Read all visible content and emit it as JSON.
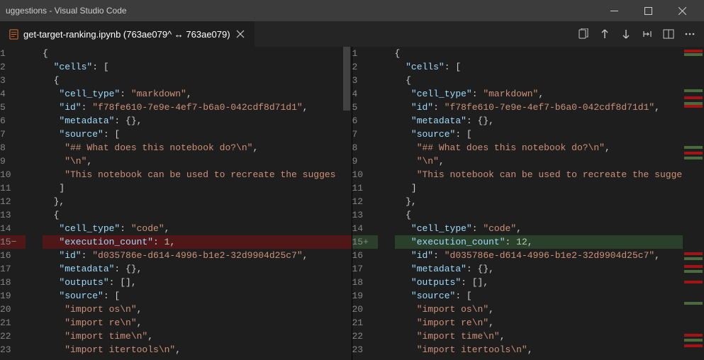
{
  "window": {
    "title_suffix": "uggestions - Visual Studio Code"
  },
  "tab": {
    "filename": "get-target-ranking.ipynb (763ae079^ ↔ 763ae079)"
  },
  "diff": {
    "left_lines": [
      {
        "n": 1,
        "tokens": [
          [
            "brace",
            "{"
          ]
        ]
      },
      {
        "n": 2,
        "tokens": [
          [
            "key",
            "  \"cells\""
          ],
          [
            "punct",
            ": ["
          ]
        ]
      },
      {
        "n": 3,
        "tokens": [
          [
            "brace",
            "  {"
          ]
        ]
      },
      {
        "n": 4,
        "tokens": [
          [
            "key",
            "   \"cell_type\""
          ],
          [
            "punct",
            ": "
          ],
          [
            "str",
            "\"markdown\""
          ],
          [
            "punct",
            ","
          ]
        ]
      },
      {
        "n": 5,
        "tokens": [
          [
            "key",
            "   \"id\""
          ],
          [
            "punct",
            ": "
          ],
          [
            "str",
            "\"f78fe610-7e9e-4ef7-b6a0-042cdf8d71d1\""
          ],
          [
            "punct",
            ","
          ]
        ]
      },
      {
        "n": 6,
        "tokens": [
          [
            "key",
            "   \"metadata\""
          ],
          [
            "punct",
            ": {},"
          ]
        ]
      },
      {
        "n": 7,
        "tokens": [
          [
            "key",
            "   \"source\""
          ],
          [
            "punct",
            ": ["
          ]
        ]
      },
      {
        "n": 8,
        "tokens": [
          [
            "str",
            "    \"## What does this notebook do?\\n\""
          ],
          [
            "punct",
            ","
          ]
        ]
      },
      {
        "n": 9,
        "tokens": [
          [
            "str",
            "    \"\\n\""
          ],
          [
            "punct",
            ","
          ]
        ]
      },
      {
        "n": 10,
        "tokens": [
          [
            "str",
            "    \"This notebook can be used to recreate the sugges"
          ]
        ]
      },
      {
        "n": 11,
        "tokens": [
          [
            "punct",
            "   ]"
          ]
        ]
      },
      {
        "n": 12,
        "tokens": [
          [
            "brace",
            "  },"
          ]
        ]
      },
      {
        "n": 13,
        "tokens": [
          [
            "brace",
            "  {"
          ]
        ]
      },
      {
        "n": 14,
        "tokens": [
          [
            "key",
            "   \"cell_type\""
          ],
          [
            "punct",
            ": "
          ],
          [
            "str",
            "\"code\""
          ],
          [
            "punct",
            ","
          ]
        ]
      },
      {
        "n": 15,
        "cls": "removed",
        "tokens": [
          [
            "key",
            "   \"execution_count\""
          ],
          [
            "punct",
            ": "
          ],
          [
            "num",
            "1"
          ],
          [
            "punct",
            ","
          ]
        ]
      },
      {
        "n": 16,
        "tokens": [
          [
            "key",
            "   \"id\""
          ],
          [
            "punct",
            ": "
          ],
          [
            "str",
            "\"d035786e-d614-4996-b1e2-32d9904d25c7\""
          ],
          [
            "punct",
            ","
          ]
        ]
      },
      {
        "n": 17,
        "tokens": [
          [
            "key",
            "   \"metadata\""
          ],
          [
            "punct",
            ": {},"
          ]
        ]
      },
      {
        "n": 18,
        "tokens": [
          [
            "key",
            "   \"outputs\""
          ],
          [
            "punct",
            ": [],"
          ]
        ]
      },
      {
        "n": 19,
        "tokens": [
          [
            "key",
            "   \"source\""
          ],
          [
            "punct",
            ": ["
          ]
        ]
      },
      {
        "n": 20,
        "tokens": [
          [
            "str",
            "    \"import os\\n\""
          ],
          [
            "punct",
            ","
          ]
        ]
      },
      {
        "n": 21,
        "tokens": [
          [
            "str",
            "    \"import re\\n\""
          ],
          [
            "punct",
            ","
          ]
        ]
      },
      {
        "n": 22,
        "tokens": [
          [
            "str",
            "    \"import time\\n\""
          ],
          [
            "punct",
            ","
          ]
        ]
      },
      {
        "n": 23,
        "tokens": [
          [
            "str",
            "    \"import itertools\\n\""
          ],
          [
            "punct",
            ","
          ]
        ]
      }
    ],
    "right_lines": [
      {
        "n": 1,
        "tokens": [
          [
            "brace",
            "{"
          ]
        ]
      },
      {
        "n": 2,
        "tokens": [
          [
            "key",
            "  \"cells\""
          ],
          [
            "punct",
            ": ["
          ]
        ]
      },
      {
        "n": 3,
        "tokens": [
          [
            "brace",
            "  {"
          ]
        ]
      },
      {
        "n": 4,
        "tokens": [
          [
            "key",
            "   \"cell_type\""
          ],
          [
            "punct",
            ": "
          ],
          [
            "str",
            "\"markdown\""
          ],
          [
            "punct",
            ","
          ]
        ]
      },
      {
        "n": 5,
        "tokens": [
          [
            "key",
            "   \"id\""
          ],
          [
            "punct",
            ": "
          ],
          [
            "str",
            "\"f78fe610-7e9e-4ef7-b6a0-042cdf8d71d1\""
          ],
          [
            "punct",
            ","
          ]
        ]
      },
      {
        "n": 6,
        "tokens": [
          [
            "key",
            "   \"metadata\""
          ],
          [
            "punct",
            ": {},"
          ]
        ]
      },
      {
        "n": 7,
        "tokens": [
          [
            "key",
            "   \"source\""
          ],
          [
            "punct",
            ": ["
          ]
        ]
      },
      {
        "n": 8,
        "tokens": [
          [
            "str",
            "    \"## What does this notebook do?\\n\""
          ],
          [
            "punct",
            ","
          ]
        ]
      },
      {
        "n": 9,
        "tokens": [
          [
            "str",
            "    \"\\n\""
          ],
          [
            "punct",
            ","
          ]
        ]
      },
      {
        "n": 10,
        "tokens": [
          [
            "str",
            "    \"This notebook can be used to recreate the sugges"
          ]
        ]
      },
      {
        "n": 11,
        "tokens": [
          [
            "punct",
            "   ]"
          ]
        ]
      },
      {
        "n": 12,
        "tokens": [
          [
            "brace",
            "  },"
          ]
        ]
      },
      {
        "n": 13,
        "tokens": [
          [
            "brace",
            "  {"
          ]
        ]
      },
      {
        "n": 14,
        "tokens": [
          [
            "key",
            "   \"cell_type\""
          ],
          [
            "punct",
            ": "
          ],
          [
            "str",
            "\"code\""
          ],
          [
            "punct",
            ","
          ]
        ]
      },
      {
        "n": 15,
        "cls": "added",
        "tokens": [
          [
            "key",
            "   \"execution_count\""
          ],
          [
            "punct",
            ": "
          ],
          [
            "num",
            "12"
          ],
          [
            "punct",
            ","
          ]
        ]
      },
      {
        "n": 16,
        "tokens": [
          [
            "key",
            "   \"id\""
          ],
          [
            "punct",
            ": "
          ],
          [
            "str",
            "\"d035786e-d614-4996-b1e2-32d9904d25c7\""
          ],
          [
            "punct",
            ","
          ]
        ]
      },
      {
        "n": 17,
        "tokens": [
          [
            "key",
            "   \"metadata\""
          ],
          [
            "punct",
            ": {},"
          ]
        ]
      },
      {
        "n": 18,
        "tokens": [
          [
            "key",
            "   \"outputs\""
          ],
          [
            "punct",
            ": [],"
          ]
        ]
      },
      {
        "n": 19,
        "tokens": [
          [
            "key",
            "   \"source\""
          ],
          [
            "punct",
            ": ["
          ]
        ]
      },
      {
        "n": 20,
        "tokens": [
          [
            "str",
            "    \"import os\\n\""
          ],
          [
            "punct",
            ","
          ]
        ]
      },
      {
        "n": 21,
        "tokens": [
          [
            "str",
            "    \"import re\\n\""
          ],
          [
            "punct",
            ","
          ]
        ]
      },
      {
        "n": 22,
        "tokens": [
          [
            "str",
            "    \"import time\\n\""
          ],
          [
            "punct",
            ","
          ]
        ]
      },
      {
        "n": 23,
        "tokens": [
          [
            "str",
            "    \"import itertools\\n\""
          ],
          [
            "punct",
            ","
          ]
        ]
      }
    ]
  },
  "gutter": {
    "removed_marker": "−",
    "added_marker": "+"
  }
}
